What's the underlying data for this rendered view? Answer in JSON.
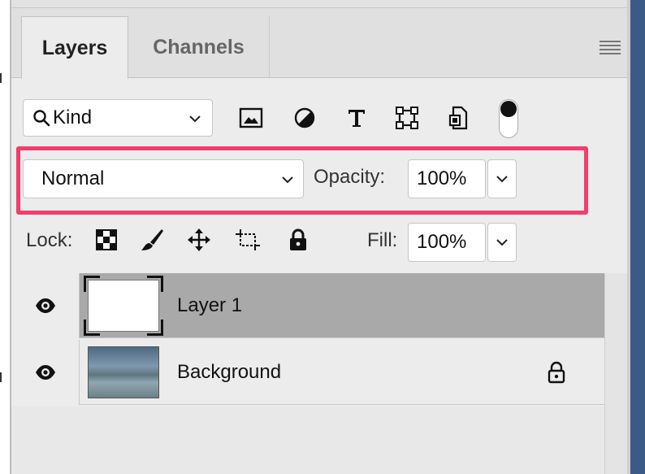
{
  "tabs": [
    {
      "label": "Layers",
      "active": true
    },
    {
      "label": "Channels",
      "active": false
    }
  ],
  "filter": {
    "kind_label": "Kind",
    "icons": [
      "image-filter-icon",
      "adjustment-filter-icon",
      "type-filter-icon",
      "shape-filter-icon",
      "smart-object-filter-icon"
    ]
  },
  "blend": {
    "mode": "Normal",
    "opacity_label": "Opacity:",
    "opacity_value": "100%"
  },
  "lock": {
    "label": "Lock:",
    "icons": [
      "lock-transparent-pixels-icon",
      "lock-image-pixels-icon",
      "lock-position-icon",
      "lock-artboard-icon",
      "lock-all-icon"
    ],
    "fill_label": "Fill:",
    "fill_value": "100%"
  },
  "layers": [
    {
      "name": "Layer 1",
      "selected": true,
      "visible": true,
      "locked": false
    },
    {
      "name": "Background",
      "selected": false,
      "visible": true,
      "locked": true
    }
  ],
  "colors": {
    "highlight": "#f23d6c",
    "selected_row": "#a9a9a9",
    "panel_bg": "#ececec"
  }
}
